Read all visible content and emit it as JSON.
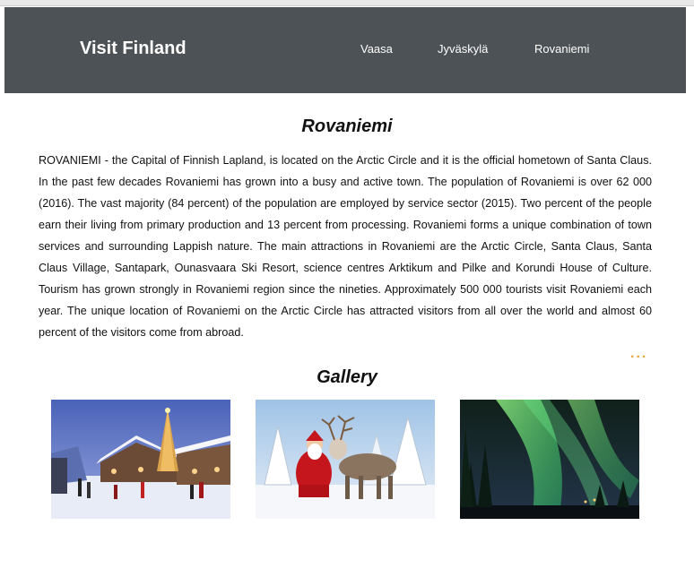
{
  "header": {
    "brand": "Visit Finland",
    "nav": [
      {
        "label": "Vaasa"
      },
      {
        "label": "Jyväskylä"
      },
      {
        "label": "Rovaniemi"
      }
    ]
  },
  "main": {
    "title": "Rovaniemi",
    "body": "ROVANIEMI - the Capital of Finnish Lapland, is located on the Arctic Circle and it is the official hometown of Santa Claus. In the past few decades Rovaniemi has grown into a busy and active town. The population of Rovaniemi is over 62 000 (2016). The vast majority (84 percent) of the population are employed by service sector (2015). Two percent of the people earn their living from primary production and 13 percent from processing. Rovaniemi forms a unique combination of town services and surrounding Lappish nature. The main attractions in Rovaniemi are the Arctic Circle, Santa Claus, Santa Claus Village, Santapark, Ounasvaara Ski Resort, science centres Arktikum and Pilke and Korundi House of Culture. Tourism has grown strongly in Rovaniemi region since the nineties. Approximately 500 000 tourists visit Rovaniemi each year. The unique location of Rovaniemi on the Arctic Circle has attracted visitors from all over the world and almost 60 percent of the visitors come from abroad.",
    "more_indicator": "...",
    "accent_color": "#e7a83a"
  },
  "gallery": {
    "title": "Gallery",
    "images": [
      {
        "icon": "santa-claus-village-winter-photo"
      },
      {
        "icon": "santa-with-reindeer-photo"
      },
      {
        "icon": "northern-lights-photo"
      }
    ]
  },
  "colors": {
    "navbar": "#4d5256",
    "nav_text": "#ffffff"
  }
}
